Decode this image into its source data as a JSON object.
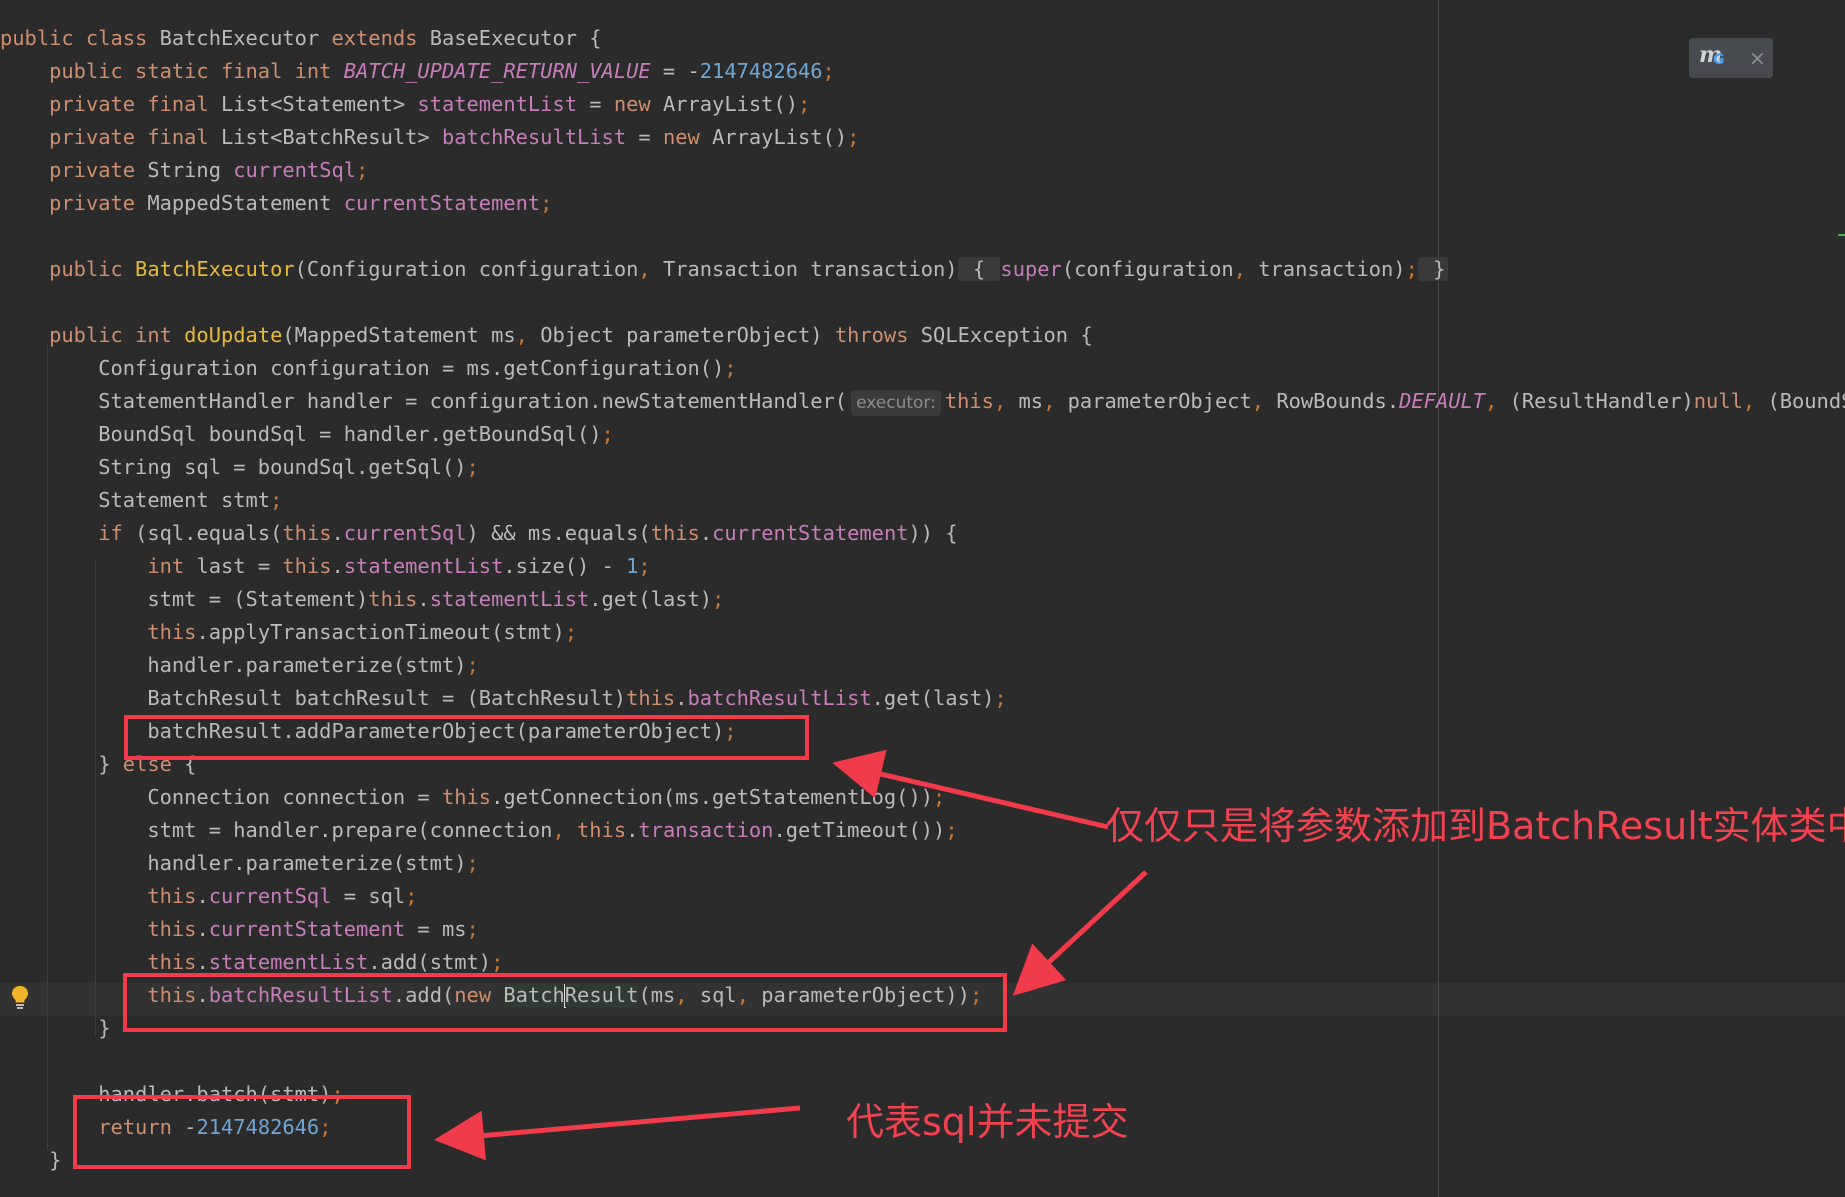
{
  "editor": {
    "lines": [
      {
        "id": "class-decl",
        "tokens": [
          [
            "kw",
            "public class "
          ],
          [
            "pl",
            "BatchExecutor "
          ],
          [
            "kw",
            "extends "
          ],
          [
            "pl",
            "BaseExecutor {"
          ]
        ]
      },
      {
        "id": "const-decl",
        "tokens": [
          [
            "pl",
            "    "
          ],
          [
            "kw",
            "public static final int "
          ],
          [
            "sfld",
            "BATCH_UPDATE_RETURN_VALUE"
          ],
          [
            "pl",
            " = -"
          ],
          [
            "num",
            "2147482646"
          ],
          [
            "punc",
            ";"
          ]
        ]
      },
      {
        "id": "field-statement-list",
        "tokens": [
          [
            "pl",
            "    "
          ],
          [
            "kw",
            "private final "
          ],
          [
            "pl",
            "List<Statement> "
          ],
          [
            "fld",
            "statementList"
          ],
          [
            "pl",
            " = "
          ],
          [
            "kw",
            "new "
          ],
          [
            "pl",
            "ArrayList()"
          ],
          [
            "punc",
            ";"
          ]
        ]
      },
      {
        "id": "field-batch-result-list",
        "tokens": [
          [
            "pl",
            "    "
          ],
          [
            "kw",
            "private final "
          ],
          [
            "pl",
            "List<BatchResult> "
          ],
          [
            "fld",
            "batchResultList"
          ],
          [
            "pl",
            " = "
          ],
          [
            "kw",
            "new "
          ],
          [
            "pl",
            "ArrayList()"
          ],
          [
            "punc",
            ";"
          ]
        ]
      },
      {
        "id": "field-current-sql",
        "tokens": [
          [
            "pl",
            "    "
          ],
          [
            "kw",
            "private "
          ],
          [
            "pl",
            "String "
          ],
          [
            "fld",
            "currentSql"
          ],
          [
            "punc",
            ";"
          ]
        ]
      },
      {
        "id": "field-current-statement",
        "tokens": [
          [
            "pl",
            "    "
          ],
          [
            "kw",
            "private "
          ],
          [
            "pl",
            "MappedStatement "
          ],
          [
            "fld",
            "currentStatement"
          ],
          [
            "punc",
            ";"
          ]
        ]
      },
      {
        "id": "blank-1",
        "tokens": []
      },
      {
        "id": "constructor",
        "tokens": [
          [
            "pl",
            "    "
          ],
          [
            "kw",
            "public "
          ],
          [
            "fnd",
            "BatchExecutor"
          ],
          [
            "pl",
            "(Configuration configuration"
          ],
          [
            "punc",
            ", "
          ],
          [
            "pl",
            "Transaction transaction)"
          ],
          [
            "fold",
            " { "
          ],
          [
            "fld",
            "super"
          ],
          [
            "pl",
            "(configuration"
          ],
          [
            "punc",
            ", "
          ],
          [
            "pl",
            "transaction)"
          ],
          [
            "punc",
            ";"
          ],
          [
            "fold",
            " }"
          ]
        ]
      },
      {
        "id": "blank-2",
        "tokens": []
      },
      {
        "id": "do-update-decl",
        "tokens": [
          [
            "pl",
            "    "
          ],
          [
            "kw",
            "public int "
          ],
          [
            "fnd",
            "doUpdate"
          ],
          [
            "pl",
            "(MappedStatement ms"
          ],
          [
            "punc",
            ", "
          ],
          [
            "pl",
            "Object parameterObject) "
          ],
          [
            "kw",
            "throws "
          ],
          [
            "pl",
            "SQLException {"
          ]
        ]
      },
      {
        "id": "configuration-line",
        "tokens": [
          [
            "pl",
            "        Configuration configuration = ms.getConfiguration()"
          ],
          [
            "punc",
            ";"
          ]
        ]
      },
      {
        "id": "handler-line",
        "tokens": [
          [
            "pl",
            "        StatementHandler handler = configuration.newStatementHandler("
          ],
          [
            "hint",
            "executor:"
          ],
          [
            "kw",
            "this"
          ],
          [
            "punc",
            ", "
          ],
          [
            "pl",
            "ms"
          ],
          [
            "punc",
            ", "
          ],
          [
            "pl",
            "parameterObject"
          ],
          [
            "punc",
            ", "
          ],
          [
            "pl",
            "RowBounds."
          ],
          [
            "sfld",
            "DEFAULT"
          ],
          [
            "punc",
            ", "
          ],
          [
            "pl",
            "(ResultHandler)"
          ],
          [
            "kw",
            "null"
          ],
          [
            "punc",
            ", "
          ],
          [
            "pl",
            "(BoundSql)"
          ]
        ]
      },
      {
        "id": "bound-sql-line",
        "tokens": [
          [
            "pl",
            "        BoundSql boundSql = handler.getBoundSql()"
          ],
          [
            "punc",
            ";"
          ]
        ]
      },
      {
        "id": "sql-line",
        "tokens": [
          [
            "pl",
            "        String sql = boundSql.getSql()"
          ],
          [
            "punc",
            ";"
          ]
        ]
      },
      {
        "id": "stmt-decl-line",
        "tokens": [
          [
            "pl",
            "        Statement stmt"
          ],
          [
            "punc",
            ";"
          ]
        ]
      },
      {
        "id": "if-line",
        "tokens": [
          [
            "pl",
            "        "
          ],
          [
            "kw",
            "if "
          ],
          [
            "pl",
            "(sql.equals("
          ],
          [
            "kw",
            "this"
          ],
          [
            "pl",
            "."
          ],
          [
            "fld",
            "currentSql"
          ],
          [
            "pl",
            ") && ms.equals("
          ],
          [
            "kw",
            "this"
          ],
          [
            "pl",
            "."
          ],
          [
            "fld",
            "currentStatement"
          ],
          [
            "pl",
            ")) {"
          ]
        ]
      },
      {
        "id": "last-line",
        "tokens": [
          [
            "pl",
            "            "
          ],
          [
            "kw",
            "int "
          ],
          [
            "pl",
            "last = "
          ],
          [
            "kw",
            "this"
          ],
          [
            "pl",
            "."
          ],
          [
            "fld",
            "statementList"
          ],
          [
            "pl",
            ".size() - "
          ],
          [
            "num",
            "1"
          ],
          [
            "punc",
            ";"
          ]
        ]
      },
      {
        "id": "stmt-get-line",
        "tokens": [
          [
            "pl",
            "            stmt = (Statement)"
          ],
          [
            "kw",
            "this"
          ],
          [
            "pl",
            "."
          ],
          [
            "fld",
            "statementList"
          ],
          [
            "pl",
            ".get(last)"
          ],
          [
            "punc",
            ";"
          ]
        ]
      },
      {
        "id": "timeout-line",
        "tokens": [
          [
            "pl",
            "            "
          ],
          [
            "kw",
            "this"
          ],
          [
            "pl",
            ".applyTransactionTimeout(stmt)"
          ],
          [
            "punc",
            ";"
          ]
        ]
      },
      {
        "id": "parameterize-line-1",
        "tokens": [
          [
            "pl",
            "            handler.parameterize(stmt)"
          ],
          [
            "punc",
            ";"
          ]
        ]
      },
      {
        "id": "batch-result-get-line",
        "tokens": [
          [
            "pl",
            "            BatchResult batchResult = (BatchResult)"
          ],
          [
            "kw",
            "this"
          ],
          [
            "pl",
            "."
          ],
          [
            "fld",
            "batchResultList"
          ],
          [
            "pl",
            ".get(last)"
          ],
          [
            "punc",
            ";"
          ]
        ]
      },
      {
        "id": "add-parameter-line",
        "tokens": [
          [
            "pl",
            "            batchResult.addParameterObject(parameterObject)"
          ],
          [
            "punc",
            ";"
          ]
        ]
      },
      {
        "id": "else-line",
        "tokens": [
          [
            "pl",
            "        } "
          ],
          [
            "kw",
            "else "
          ],
          [
            "pl",
            "{"
          ]
        ]
      },
      {
        "id": "connection-line",
        "tokens": [
          [
            "pl",
            "            Connection connection = "
          ],
          [
            "kw",
            "this"
          ],
          [
            "pl",
            ".getConnection(ms.getStatementLog())"
          ],
          [
            "punc",
            ";"
          ]
        ]
      },
      {
        "id": "prepare-line",
        "tokens": [
          [
            "pl",
            "            stmt = handler.prepare(connection"
          ],
          [
            "punc",
            ", "
          ],
          [
            "kw",
            "this"
          ],
          [
            "pl",
            "."
          ],
          [
            "fld",
            "transaction"
          ],
          [
            "pl",
            ".getTimeout())"
          ],
          [
            "punc",
            ";"
          ]
        ]
      },
      {
        "id": "parameterize-line-2",
        "tokens": [
          [
            "pl",
            "            handler.parameterize(stmt)"
          ],
          [
            "punc",
            ";"
          ]
        ]
      },
      {
        "id": "set-current-sql-line",
        "tokens": [
          [
            "pl",
            "            "
          ],
          [
            "kw",
            "this"
          ],
          [
            "pl",
            "."
          ],
          [
            "fld",
            "currentSql"
          ],
          [
            "pl",
            " = sql"
          ],
          [
            "punc",
            ";"
          ]
        ]
      },
      {
        "id": "set-current-statement-line",
        "tokens": [
          [
            "pl",
            "            "
          ],
          [
            "kw",
            "this"
          ],
          [
            "pl",
            "."
          ],
          [
            "fld",
            "currentStatement"
          ],
          [
            "pl",
            " = ms"
          ],
          [
            "punc",
            ";"
          ]
        ]
      },
      {
        "id": "statement-list-add-line",
        "tokens": [
          [
            "pl",
            "            "
          ],
          [
            "kw",
            "this"
          ],
          [
            "pl",
            "."
          ],
          [
            "fld",
            "statementList"
          ],
          [
            "pl",
            ".add(stmt)"
          ],
          [
            "punc",
            ";"
          ]
        ]
      },
      {
        "id": "batch-result-list-add-line",
        "tokens": [
          [
            "pl",
            "            "
          ],
          [
            "kw",
            "this"
          ],
          [
            "pl",
            "."
          ],
          [
            "fld",
            "batchResultList"
          ],
          [
            "pl",
            ".add("
          ],
          [
            "kw",
            "new "
          ],
          [
            "ref",
            "Batch"
          ],
          [
            "caret",
            ""
          ],
          [
            "ref",
            "Result"
          ],
          [
            "pl",
            "(ms"
          ],
          [
            "punc",
            ", "
          ],
          [
            "pl",
            "sql"
          ],
          [
            "punc",
            ", "
          ],
          [
            "pl",
            "parameterObject))"
          ],
          [
            "punc",
            ";"
          ]
        ]
      },
      {
        "id": "close-else-line",
        "tokens": [
          [
            "pl",
            "        }"
          ]
        ]
      },
      {
        "id": "blank-3",
        "tokens": []
      },
      {
        "id": "batch-line",
        "tokens": [
          [
            "pl",
            "        handler.batch(stmt)"
          ],
          [
            "punc",
            ";"
          ]
        ]
      },
      {
        "id": "return-line",
        "tokens": [
          [
            "pl",
            "        "
          ],
          [
            "kw",
            "return "
          ],
          [
            "pl",
            "-"
          ],
          [
            "num",
            "2147482646"
          ],
          [
            "punc",
            ";"
          ]
        ]
      },
      {
        "id": "close-method-line",
        "tokens": [
          [
            "pl",
            "    }"
          ]
        ]
      }
    ]
  },
  "annotations": {
    "param_note": "仅仅只是将参数添加到BatchResult实体类中",
    "sql_note": "代表sql并未提交"
  },
  "widget": {
    "letter": "m",
    "badge": "G",
    "close": "×"
  },
  "colors": {
    "background": "#2b2b2b",
    "keyword": "#cf8e6d",
    "field": "#c77dbb",
    "number": "#6fa6d6",
    "plain": "#bababa",
    "annotation_red": "#f23b4a"
  }
}
